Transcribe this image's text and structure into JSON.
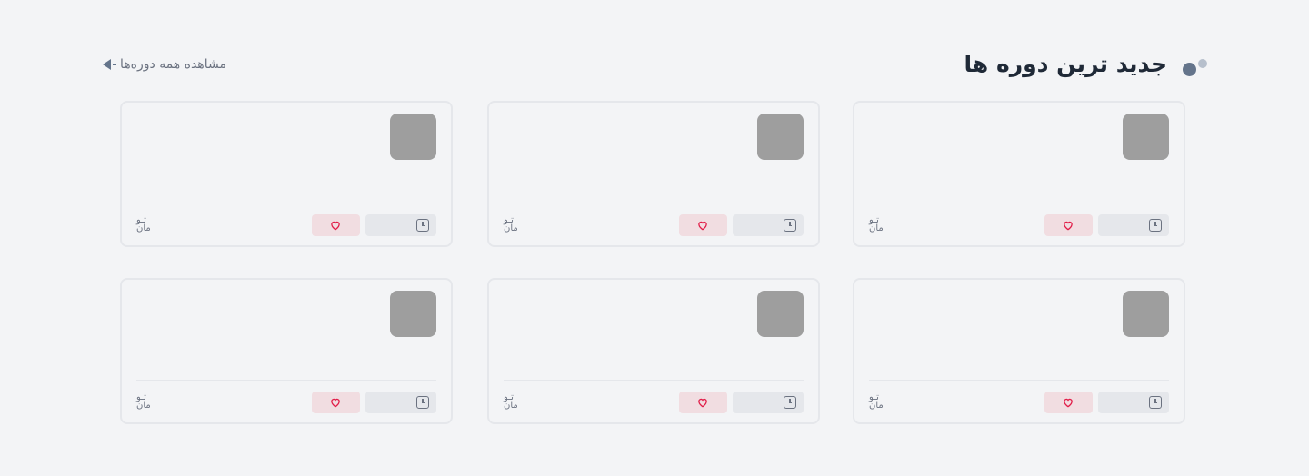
{
  "section": {
    "title": "جدید ترین دوره ها",
    "see_all_label": "مشاهده همه دوره‌ها"
  },
  "colors": {
    "background": "#f3f4f6",
    "thumbnail_placeholder": "#9e9e9e",
    "like_accent": "#e11d48",
    "muted_text": "#6b7280"
  },
  "cards": [
    {
      "currency_line1": "تـو",
      "currency_line2": "مان",
      "time_icon": "clock-icon",
      "like_icon": "heart-icon"
    },
    {
      "currency_line1": "تـو",
      "currency_line2": "مان",
      "time_icon": "clock-icon",
      "like_icon": "heart-icon"
    },
    {
      "currency_line1": "تـو",
      "currency_line2": "مان",
      "time_icon": "clock-icon",
      "like_icon": "heart-icon"
    },
    {
      "currency_line1": "تـو",
      "currency_line2": "مان",
      "time_icon": "clock-icon",
      "like_icon": "heart-icon"
    },
    {
      "currency_line1": "تـو",
      "currency_line2": "مان",
      "time_icon": "clock-icon",
      "like_icon": "heart-icon"
    },
    {
      "currency_line1": "تـو",
      "currency_line2": "مان",
      "time_icon": "clock-icon",
      "like_icon": "heart-icon"
    }
  ]
}
